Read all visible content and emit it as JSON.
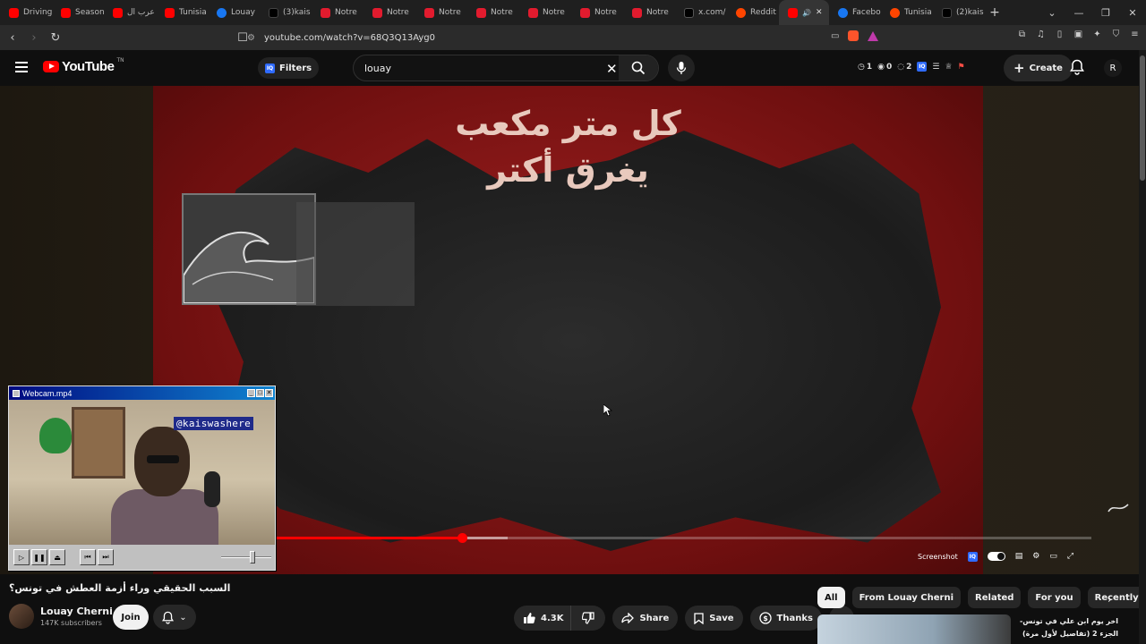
{
  "browser": {
    "tabs": [
      {
        "label": "Driving",
        "fav": "yt"
      },
      {
        "label": "Season",
        "fav": "yt"
      },
      {
        "label": "عرب ال",
        "fav": "yt"
      },
      {
        "label": "Tunisia",
        "fav": "yt"
      },
      {
        "label": "Louay",
        "fav": "fb"
      },
      {
        "label": "(3)kais",
        "fav": "tt"
      },
      {
        "label": "Notre",
        "fav": "nd"
      },
      {
        "label": "Notre",
        "fav": "nd"
      },
      {
        "label": "Notre",
        "fav": "nd"
      },
      {
        "label": "Notre",
        "fav": "nd"
      },
      {
        "label": "Notre",
        "fav": "nd"
      },
      {
        "label": "Notre",
        "fav": "nd"
      },
      {
        "label": "Notre",
        "fav": "nd"
      },
      {
        "label": "x.com/",
        "fav": "xx"
      },
      {
        "label": "Reddit",
        "fav": "rd"
      },
      {
        "label": "",
        "fav": "yt",
        "active": true
      },
      {
        "label": "Facebo",
        "fav": "fb"
      },
      {
        "label": "Tunisia",
        "fav": "rd"
      },
      {
        "label": "(2)kais",
        "fav": "tt"
      }
    ],
    "url": "youtube.com/watch?v=68Q3Q13Ayg0"
  },
  "masthead": {
    "logo_text": "YouTube",
    "logo_suffix": "TN",
    "filters_label": "Filters",
    "search_value": "louay",
    "stats": [
      "1",
      "0",
      "2"
    ],
    "create_label": "Create",
    "avatar_letter": "R"
  },
  "video": {
    "headline_line1": "كل متر مكعب",
    "headline_line2": "يغرق أكتر",
    "progress_played": 0.227,
    "progress_loaded": 0.283,
    "screenshot_label": "Screenshot"
  },
  "webcam": {
    "title": "Webcam.mp4",
    "handle": "@kaiswashere"
  },
  "watch": {
    "title": "السبب الحقيقي وراء أزمة العطش في تونس؟",
    "channel_name": "Louay Cherni",
    "subscribers": "147K subscribers",
    "join_label": "Join",
    "like_count": "4.3K",
    "share_label": "Share",
    "save_label": "Save",
    "thanks_label": "Thanks"
  },
  "sidebar": {
    "chips": [
      "All",
      "From Louay Cherni",
      "Related",
      "For you",
      "Recently uploa"
    ],
    "rec_title": "اخر يوم ابن علي في تونس- الجزء 2 (تفاصيل لأول مرة)"
  },
  "colors": {
    "accent_red": "#ff0000",
    "background": "#0f0f0f"
  }
}
